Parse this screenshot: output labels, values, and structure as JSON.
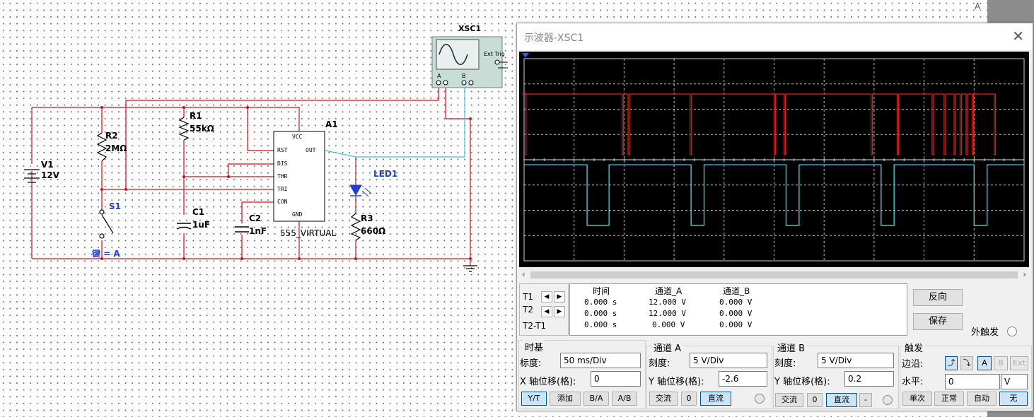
{
  "schematic": {
    "oscilloscope_label": "XSC1",
    "ext_trig": "Ext Trig",
    "ch_a": "A",
    "ch_b": "B",
    "v1_name": "V1",
    "v1_value": "12V",
    "r2_name": "R2",
    "r2_value": "2MΩ",
    "r1_name": "R1",
    "r1_value": "55kΩ",
    "s1_name": "S1",
    "key_label": "键 = A",
    "c1_name": "C1",
    "c1_value": "1uF",
    "c2_name": "C2",
    "c2_value": "1nF",
    "a1_name": "A1",
    "a1_type": "555_VIRTUAL",
    "led_name": "LED1",
    "r3_name": "R3",
    "r3_value": "660Ω",
    "pins": {
      "vcc": "VCC",
      "rst": "RST",
      "out": "OUT",
      "dis": "DIS",
      "thr": "THR",
      "tri": "TRI",
      "con": "CON",
      "gnd": "GND"
    }
  },
  "right_edge_letter": "A",
  "scope": {
    "title": "示波器-XSC1",
    "close_icon": "close-icon",
    "colors": {
      "channel_a": "#4fd5e8",
      "channel_b": "#d21e1e",
      "screen_bg": "#000000"
    },
    "measurement": {
      "headers": [
        "时间",
        "通道_A",
        "通道_B"
      ],
      "rows": [
        {
          "label": "T1",
          "time": "0.000 s",
          "a": "12.000 V",
          "b": "0.000 V"
        },
        {
          "label": "T2",
          "time": "0.000 s",
          "a": "12.000 V",
          "b": "0.000 V"
        },
        {
          "label": "T2-T1",
          "time": "0.000 s",
          "a": "0.000 V",
          "b": "0.000 V"
        }
      ]
    },
    "buttons": {
      "reverse": "反向",
      "save": "保存"
    },
    "ext_trigger_label": "外触发",
    "timebase": {
      "title": "时基",
      "scale_label": "标度:",
      "scale_value": "50 ms/Div",
      "xpos_label": "X 轴位移(格):",
      "xpos_value": "0",
      "modes": [
        "Y/T",
        "添加",
        "B/A",
        "A/B"
      ]
    },
    "channel_a": {
      "title": "通道 A",
      "scale_label": "刻度:",
      "scale_value": "5  V/Div",
      "ypos_label": "Y 轴位移(格):",
      "ypos_value": "-2.6",
      "coupling": [
        "交流",
        "0",
        "直流"
      ]
    },
    "channel_b": {
      "title": "通道 B",
      "scale_label": "刻度:",
      "scale_value": "5  V/Div",
      "ypos_label": "Y 轴位移(格):",
      "ypos_value": "0.2",
      "coupling": [
        "交流",
        "0",
        "直流",
        "-"
      ]
    },
    "trigger": {
      "title": "触发",
      "edge_label": "边沿:",
      "level_label": "水平:",
      "level_value": "0",
      "level_unit": "V",
      "sources": [
        "A",
        "B",
        "Ext"
      ],
      "modes": [
        "单次",
        "正常",
        "自动",
        "无"
      ]
    }
  },
  "chart_data": {
    "type": "line",
    "xlabel": "",
    "ylabel": "",
    "x_divisions": 10,
    "y_divisions": 8,
    "x_unit": "ms",
    "time_per_div": 50,
    "xlim": [
      0,
      500
    ],
    "series": [
      {
        "channel": "A",
        "color": "#4fd5e8",
        "volts_per_div": 5,
        "offset_div": -2.6,
        "levels_V": [
          0,
          12
        ],
        "transitions_ms": [
          0,
          63,
          85,
          167,
          180,
          262,
          275,
          357,
          370,
          450,
          463
        ]
      },
      {
        "channel": "B",
        "color": "#d21e1e",
        "volts_per_div": 5,
        "offset_div": 0.2,
        "levels_V": [
          0,
          12
        ],
        "pulse_times_ms": [
          2,
          98,
          104,
          166,
          250,
          260,
          347,
          373,
          408,
          420,
          430,
          436,
          442,
          448,
          470,
          539
        ]
      }
    ]
  }
}
